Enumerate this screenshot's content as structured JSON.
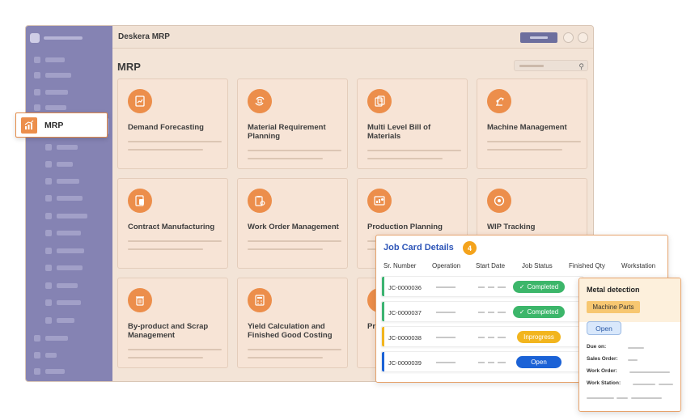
{
  "app": {
    "title": "Deskera MRP"
  },
  "main": {
    "title": "MRP"
  },
  "cards": [
    {
      "title": "Demand Forecasting",
      "icon": "chart-doc-icon"
    },
    {
      "title": "Material Requirement Planning",
      "icon": "cycle-icon"
    },
    {
      "title": "Multi Level Bill of Materials",
      "icon": "documents-icon"
    },
    {
      "title": "Machine Management",
      "icon": "robot-arm-icon"
    },
    {
      "title": "Contract Manufacturing",
      "icon": "contract-icon"
    },
    {
      "title": "Work Order Management",
      "icon": "clipboard-gear-icon"
    },
    {
      "title": "Production Planning",
      "icon": "planning-icon"
    },
    {
      "title": "WIP Tracking",
      "icon": "tracking-icon"
    },
    {
      "title": "By-product and Scrap Management",
      "icon": "recycle-bin-icon"
    },
    {
      "title": "Yield Calculation and Finished Good Costing",
      "icon": "calculator-icon"
    },
    {
      "title": "Pr",
      "icon": "partial-icon"
    }
  ],
  "callout": {
    "label": "MRP"
  },
  "job_card": {
    "title": "Job Card Details",
    "count": "4",
    "columns": [
      "Sr. Number",
      "Operation",
      "Start Date",
      "Job Status",
      "Finished Qty",
      "Workstation"
    ],
    "rows": [
      {
        "id": "JC-0000036",
        "status": "Completed",
        "stripe": "#3cb371",
        "status_color": "#3cb66a"
      },
      {
        "id": "JC-0000037",
        "status": "Completed",
        "stripe": "#3cb371",
        "status_color": "#3cb66a"
      },
      {
        "id": "JC-0000038",
        "status": "Inprogress",
        "stripe": "#f2b51e",
        "status_color": "#f2b51e"
      },
      {
        "id": "JC-0000039",
        "status": "Open",
        "stripe": "#1b62d6",
        "status_color": "#1b62d6"
      }
    ]
  },
  "metal": {
    "title": "Metal detection",
    "tag": "Machine Parts",
    "status": "Open",
    "fields": [
      "Due on:",
      "Sales Order:",
      "Work Order:",
      "Work Station:"
    ]
  },
  "colors": {
    "accent": "#ec8e4b",
    "sidebar": "#8583b3",
    "link": "#2e56b8"
  }
}
